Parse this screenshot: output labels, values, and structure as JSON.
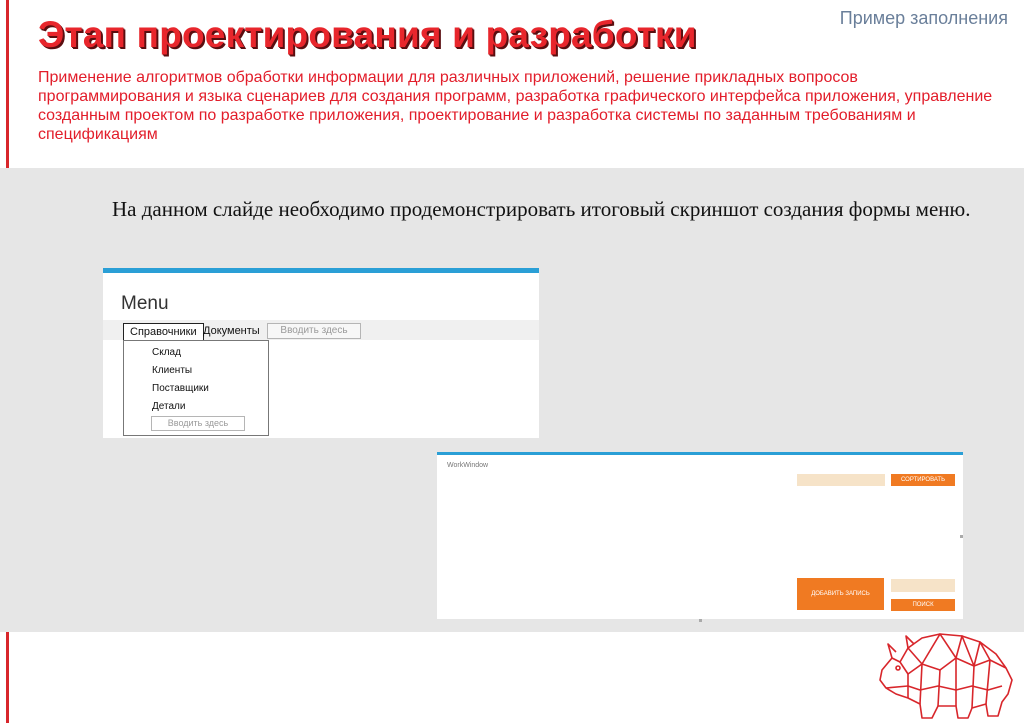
{
  "header": {
    "title": "Этап проектирования и разработки",
    "sample_label": "Пример заполнения",
    "description": "Применение алгоритмов обработки информации для различных приложений, решение прикладных вопросов программирования и языка сценариев для создания программ, разработка графического интерфейса приложения, управление созданным проектом по разработке приложения, проектирование и разработка системы по заданным требованиям и спецификациям"
  },
  "body": {
    "instruction": "На данном слайде необходимо продемонстрировать итоговый скриншот создания формы меню."
  },
  "menu_form": {
    "title": "Menu",
    "menu_items": [
      "Справочники",
      "Документы"
    ],
    "type_here": "Вводить здесь",
    "dropdown_items": [
      "Склад",
      "Клиенты",
      "Поставщики",
      "Детали"
    ],
    "dropdown_type_here": "Вводить здесь"
  },
  "work_window": {
    "title": "WorkWindow",
    "sort_button": "СОРТИРОВАТЬ",
    "add_button": "ДОБАВИТЬ ЗАПИСЬ",
    "search_button": "ПОИСК"
  },
  "colors": {
    "title_red": "#e8262c",
    "text_red": "#e21d2a",
    "accent_blue": "#2a9fd6",
    "button_orange": "#f07a22",
    "textbox_beige": "#f6e3c8",
    "panel_gray": "#e6e6e6"
  },
  "icons": {
    "logo": "rhino-logo-icon"
  }
}
